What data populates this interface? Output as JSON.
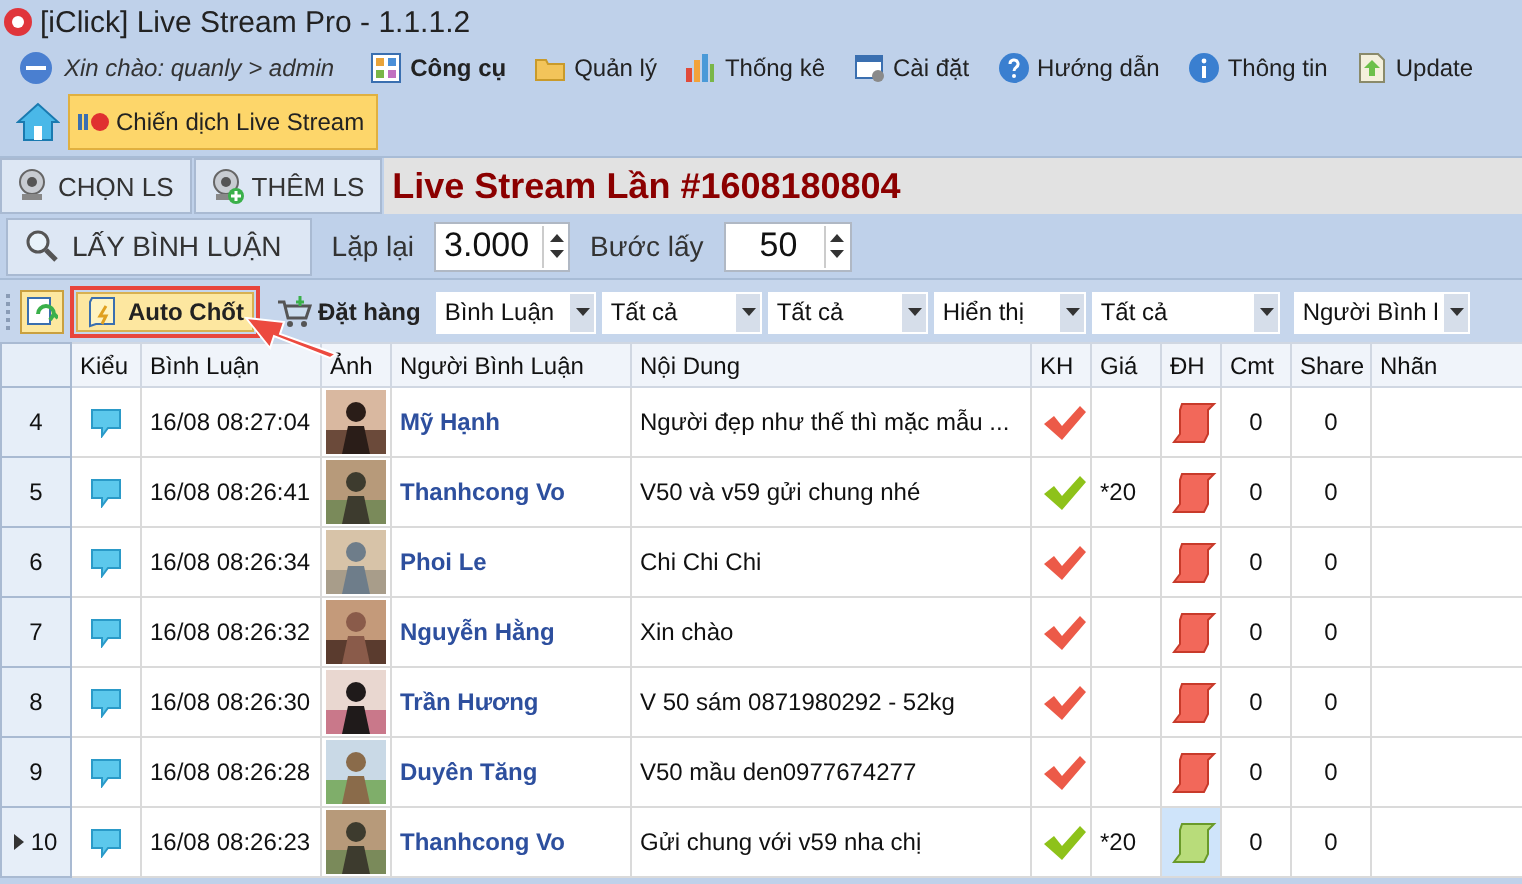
{
  "window": {
    "title": "[iClick] Live Stream Pro - 1.1.1.2"
  },
  "menu": {
    "greeting": "Xin chào: quanly > admin",
    "items": [
      {
        "label": "Công cụ",
        "kind": "tools",
        "bold": true
      },
      {
        "label": "Quản lý",
        "kind": "folder",
        "bold": false
      },
      {
        "label": "Thống kê",
        "kind": "chart",
        "bold": false
      },
      {
        "label": "Cài đặt",
        "kind": "settings",
        "bold": false
      },
      {
        "label": "Hướng dẫn",
        "kind": "help",
        "bold": false
      },
      {
        "label": "Thông tin",
        "kind": "info",
        "bold": false
      },
      {
        "label": "Update",
        "kind": "update",
        "bold": false
      }
    ]
  },
  "ribbon_tabs": [
    {
      "label": "Chiến dịch Live Stream",
      "selected": true
    }
  ],
  "ls_buttons": [
    {
      "label": "CHỌN LS",
      "kind": "camera"
    },
    {
      "label": "THÊM LS",
      "kind": "camera-add"
    }
  ],
  "campaign_title": "Live Stream Lần #1608180804",
  "fetch": {
    "button": "LẤY BÌNH LUẬN",
    "repeat_label": "Lặp lại",
    "repeat_value": "3.000",
    "step_label": "Bước lấy",
    "step_value": "50"
  },
  "toolbar": {
    "buttons": [
      {
        "label": "Auto Chốt",
        "kind": "auto",
        "highlighted": true
      },
      {
        "label": "Đặt hàng",
        "kind": "order",
        "highlighted": false
      }
    ],
    "filters": [
      "Bình Luận",
      "Tất cả",
      "Tất cả",
      "Hiển thị",
      "Tất cả",
      "Người Bình l"
    ]
  },
  "table": {
    "columns": [
      "Kiểu",
      "Bình Luận",
      "Ảnh",
      "Người Bình Luận",
      "Nội Dung",
      "KH",
      "Giá",
      "ĐH",
      "Cmt",
      "Share",
      "Nhãn"
    ],
    "rows": [
      {
        "no": "4",
        "time": "16/08 08:27:04",
        "name": "Mỹ Hạnh",
        "content": "Người đẹp như thế thì mặc mẫu ...",
        "matched": false,
        "price": "",
        "ordered": false,
        "cmt": "0",
        "share": "0",
        "current": false
      },
      {
        "no": "5",
        "time": "16/08 08:26:41",
        "name": "Thanhcong Vo",
        "content": "V50 và v59 gửi chung nhé",
        "matched": true,
        "price": "*20",
        "ordered": false,
        "cmt": "0",
        "share": "0",
        "current": false
      },
      {
        "no": "6",
        "time": "16/08 08:26:34",
        "name": "Phoi Le",
        "content": "Chi  Chi  Chi",
        "matched": false,
        "price": "",
        "ordered": false,
        "cmt": "0",
        "share": "0",
        "current": false
      },
      {
        "no": "7",
        "time": "16/08 08:26:32",
        "name": "Nguyễn Hằng",
        "content": "Xin chào",
        "matched": false,
        "price": "",
        "ordered": false,
        "cmt": "0",
        "share": "0",
        "current": false
      },
      {
        "no": "8",
        "time": "16/08 08:26:30",
        "name": "Trần Hương",
        "content": "V 50 sám 0871980292 - 52kg",
        "matched": false,
        "price": "",
        "ordered": false,
        "cmt": "0",
        "share": "0",
        "current": false
      },
      {
        "no": "9",
        "time": "16/08 08:26:28",
        "name": "Duyên Tăng",
        "content": "V50 mầu den0977674277",
        "matched": false,
        "price": "",
        "ordered": false,
        "cmt": "0",
        "share": "0",
        "current": false
      },
      {
        "no": "10",
        "time": "16/08 08:26:23",
        "name": "Thanhcong Vo",
        "content": "Gửi chung với v59 nha chị",
        "matched": true,
        "price": "*20",
        "ordered": true,
        "cmt": "0",
        "share": "0",
        "current": true
      }
    ]
  }
}
